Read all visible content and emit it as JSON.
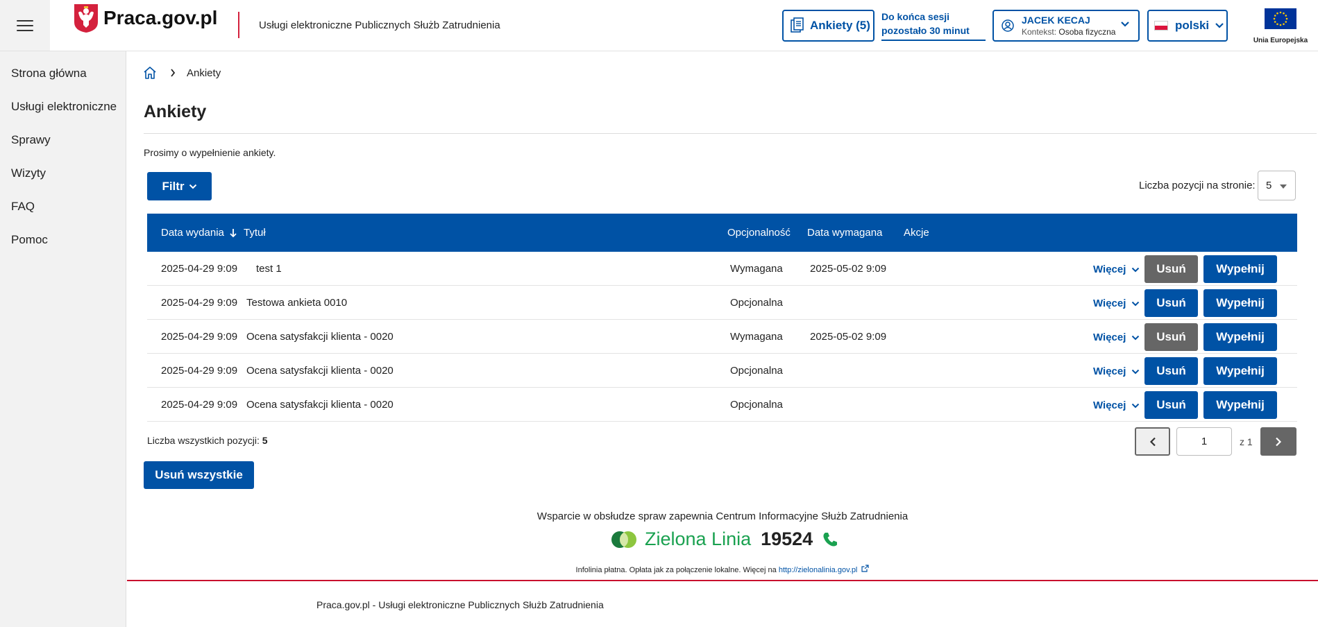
{
  "header": {
    "logo_text": "Praca.gov.pl",
    "service_name": "Usługi elektroniczne Publicznych Służb Zatrudnienia",
    "surveys_label": "Ankiety (5)",
    "session_line1": "Do końca sesji",
    "session_line2": "pozostało 30 minut",
    "user_name": "JACEK KECAJ",
    "context_label": "Kontekst:",
    "context_value": "Osoba fizyczna",
    "language": "polski",
    "eu_label": "Unia Europejska"
  },
  "sidebar": {
    "items": [
      {
        "label": "Strona główna"
      },
      {
        "label": "Usługi elektroniczne"
      },
      {
        "label": "Sprawy"
      },
      {
        "label": "Wizyty"
      },
      {
        "label": "FAQ"
      },
      {
        "label": "Pomoc"
      }
    ]
  },
  "breadcrumb": {
    "current": "Ankiety"
  },
  "page": {
    "title": "Ankiety",
    "intro": "Prosimy o wypełnienie ankiety.",
    "filter_label": "Filtr",
    "page_size_label": "Liczba pozycji na stronie:",
    "page_size_value": "5"
  },
  "table": {
    "columns": {
      "date": "Data wydania",
      "title": "Tytuł",
      "optional": "Opcjonalność",
      "due": "Data wymagana",
      "actions": "Akcje"
    },
    "more_label": "Więcej",
    "delete_label": "Usuń",
    "fill_label": "Wypełnij",
    "rows": [
      {
        "date": "2025-04-29 9:09",
        "title": "test 1",
        "optional": "Wymagana",
        "due": "2025-05-02 9:09"
      },
      {
        "date": "2025-04-29 9:09",
        "title": "Testowa ankieta 0010",
        "optional": "Opcjonalna",
        "due": ""
      },
      {
        "date": "2025-04-29 9:09",
        "title": "Ocena satysfakcji klienta - 0020",
        "optional": "Wymagana",
        "due": "2025-05-02 9:09"
      },
      {
        "date": "2025-04-29 9:09",
        "title": "Ocena satysfakcji klienta - 0020",
        "optional": "Opcjonalna",
        "due": ""
      },
      {
        "date": "2025-04-29 9:09",
        "title": "Ocena satysfakcji klienta - 0020",
        "optional": "Opcjonalna",
        "due": ""
      }
    ]
  },
  "pagination": {
    "total_label": "Liczba wszystkich pozycji:",
    "total_value": "5",
    "current_page": "1",
    "of_pages": "z 1"
  },
  "delete_all_label": "Usuń wszystkie",
  "footer": {
    "support_text": "Wsparcie w obsłudze spraw zapewnia Centrum Informacyjne Służb Zatrudnienia",
    "green_line_name": "Zielona Linia",
    "green_line_number": "19524",
    "infoline_text": "Infolinia płatna. Opłata jak za połączenie lokalne. Więcej na",
    "infoline_link": "http://zielonalinia.gov.pl",
    "bottom_text": "Praca.gov.pl - Usługi elektroniczne Publicznych Służb Zatrudnienia"
  },
  "colors": {
    "primary": "#0052a5",
    "disabled_button": "#666666",
    "accent_red": "#c8102e",
    "green": "#1aa150"
  }
}
